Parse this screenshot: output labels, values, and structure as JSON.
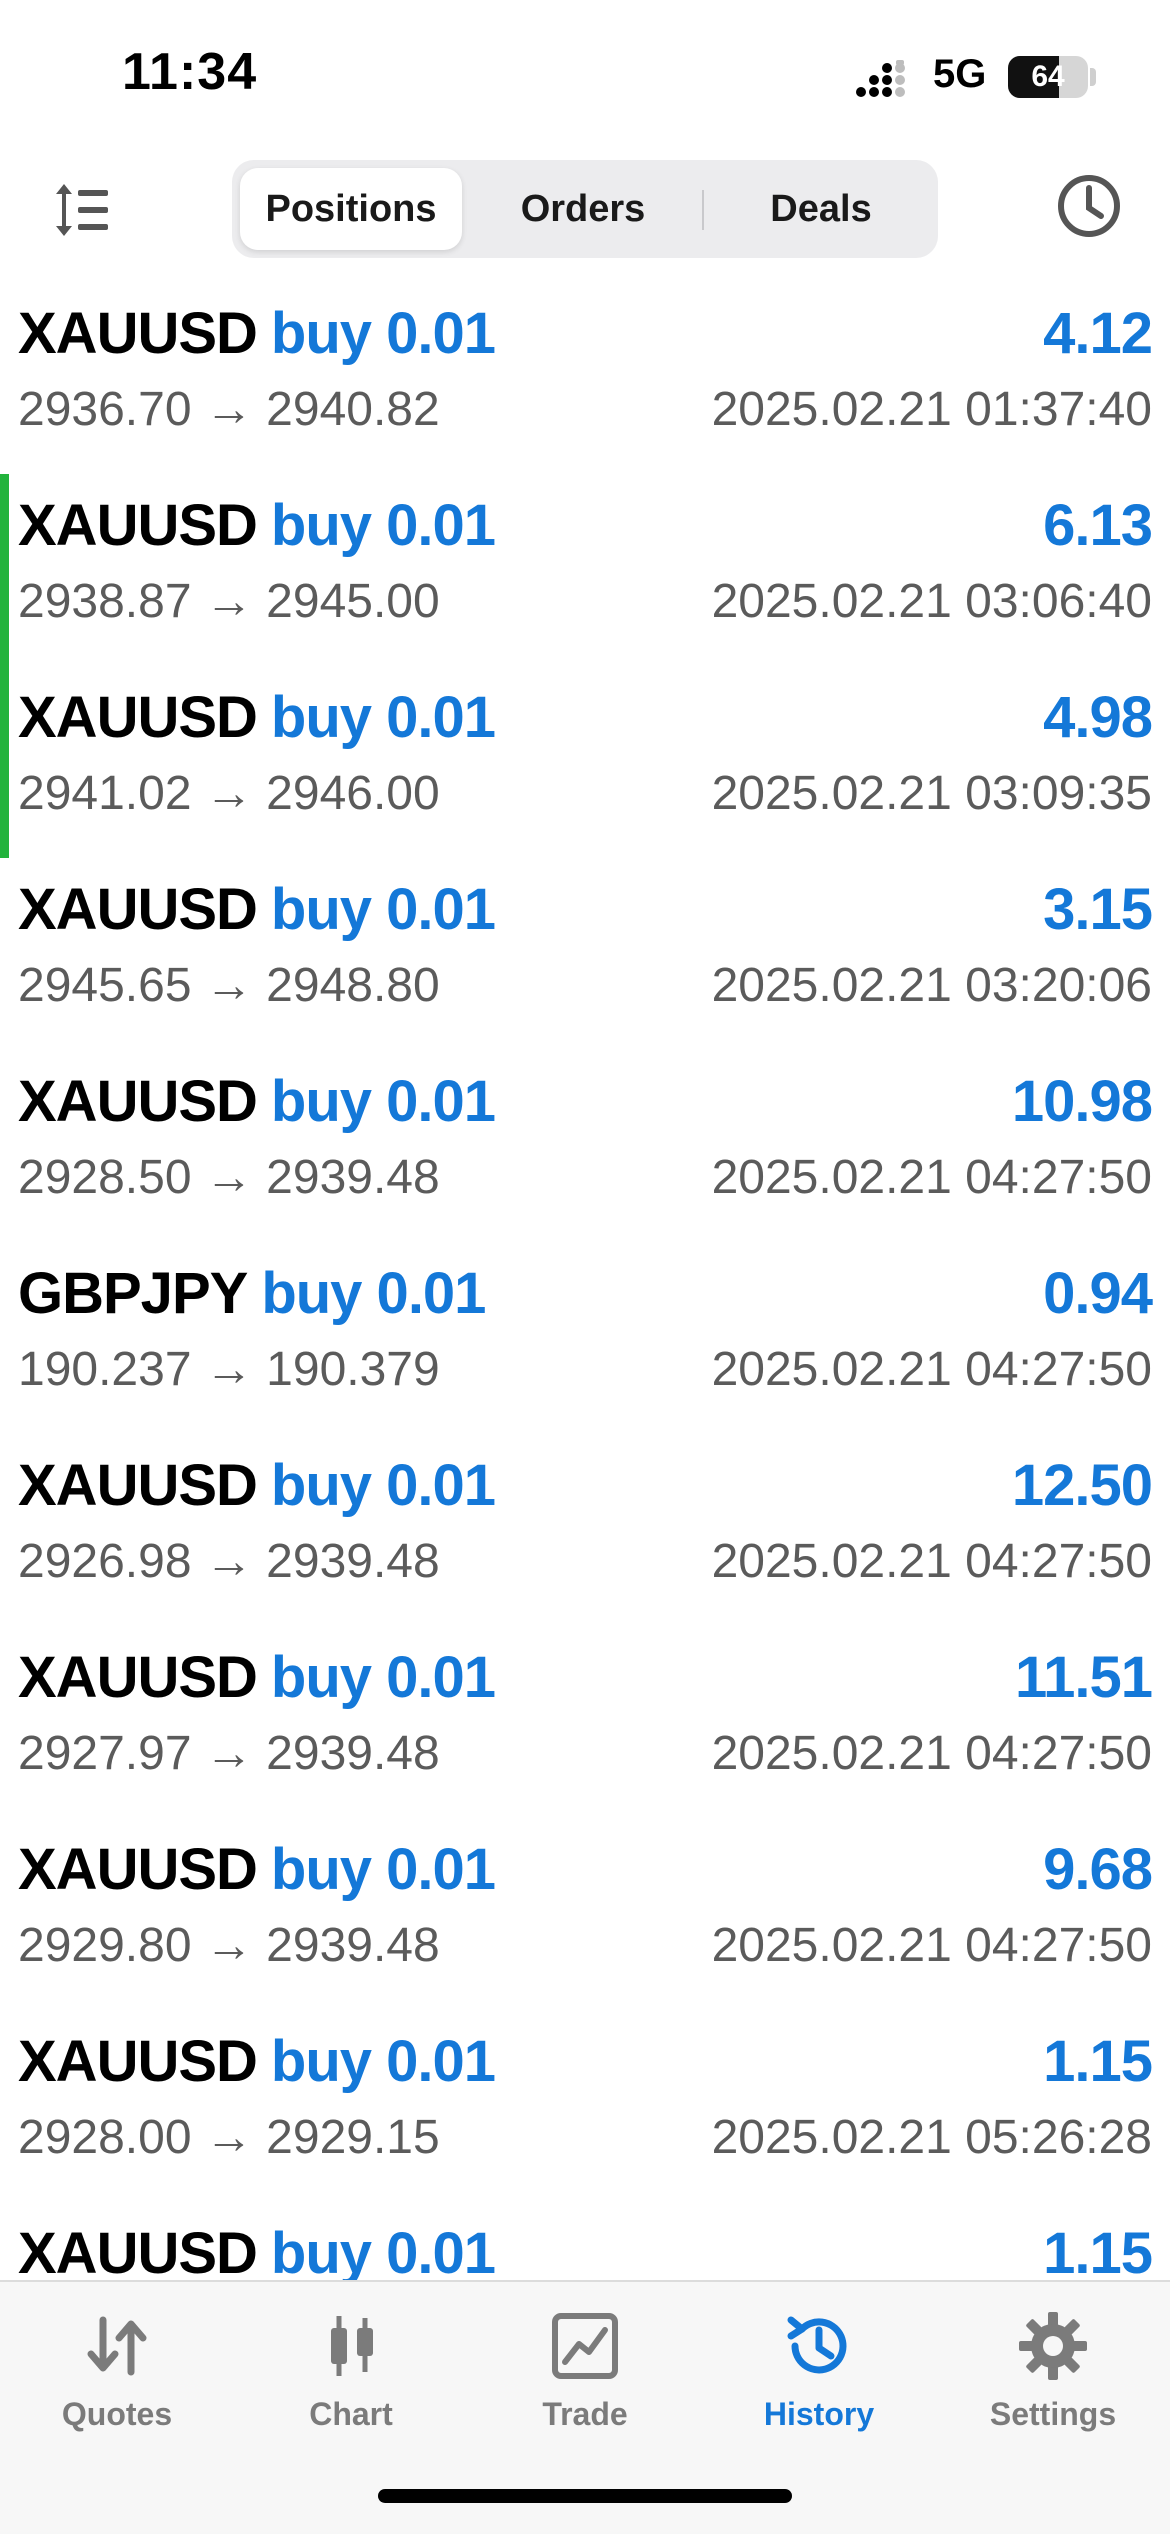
{
  "status_bar": {
    "time": "11:34",
    "network": "5G",
    "battery": "64",
    "battery_level_percent": 64
  },
  "tabs": {
    "positions": "Positions",
    "orders": "Orders",
    "deals": "Deals",
    "active": "positions"
  },
  "colors": {
    "accent": "#1478d8",
    "marker": "#22b33c"
  },
  "deals": [
    {
      "symbol": "XAUUSD",
      "side": "buy 0.01",
      "profit": "4.12",
      "prices": "2936.70 → 2940.82",
      "time": "2025.02.21 01:37:40",
      "marked": false
    },
    {
      "symbol": "XAUUSD",
      "side": "buy 0.01",
      "profit": "6.13",
      "prices": "2938.87 → 2945.00",
      "time": "2025.02.21 03:06:40",
      "marked": true
    },
    {
      "symbol": "XAUUSD",
      "side": "buy 0.01",
      "profit": "4.98",
      "prices": "2941.02 → 2946.00",
      "time": "2025.02.21 03:09:35",
      "marked": true
    },
    {
      "symbol": "XAUUSD",
      "side": "buy 0.01",
      "profit": "3.15",
      "prices": "2945.65 → 2948.80",
      "time": "2025.02.21 03:20:06",
      "marked": false
    },
    {
      "symbol": "XAUUSD",
      "side": "buy 0.01",
      "profit": "10.98",
      "prices": "2928.50 → 2939.48",
      "time": "2025.02.21 04:27:50",
      "marked": false
    },
    {
      "symbol": "GBPJPY",
      "side": "buy 0.01",
      "profit": "0.94",
      "prices": "190.237 → 190.379",
      "time": "2025.02.21 04:27:50",
      "marked": false
    },
    {
      "symbol": "XAUUSD",
      "side": "buy 0.01",
      "profit": "12.50",
      "prices": "2926.98 → 2939.48",
      "time": "2025.02.21 04:27:50",
      "marked": false
    },
    {
      "symbol": "XAUUSD",
      "side": "buy 0.01",
      "profit": "11.51",
      "prices": "2927.97 → 2939.48",
      "time": "2025.02.21 04:27:50",
      "marked": false
    },
    {
      "symbol": "XAUUSD",
      "side": "buy 0.01",
      "profit": "9.68",
      "prices": "2929.80 → 2939.48",
      "time": "2025.02.21 04:27:50",
      "marked": false
    },
    {
      "symbol": "XAUUSD",
      "side": "buy 0.01",
      "profit": "1.15",
      "prices": "2928.00 → 2929.15",
      "time": "2025.02.21 05:26:28",
      "marked": false
    },
    {
      "symbol": "XAUUSD",
      "side": "buy 0.01",
      "profit": "1.15",
      "prices": "",
      "time": "",
      "marked": false
    }
  ],
  "nav": [
    {
      "label": "Quotes",
      "icon": "quotes-icon",
      "active": false
    },
    {
      "label": "Chart",
      "icon": "chart-icon",
      "active": false
    },
    {
      "label": "Trade",
      "icon": "trade-icon",
      "active": false
    },
    {
      "label": "History",
      "icon": "history-icon",
      "active": true
    },
    {
      "label": "Settings",
      "icon": "settings-icon",
      "active": false
    }
  ]
}
